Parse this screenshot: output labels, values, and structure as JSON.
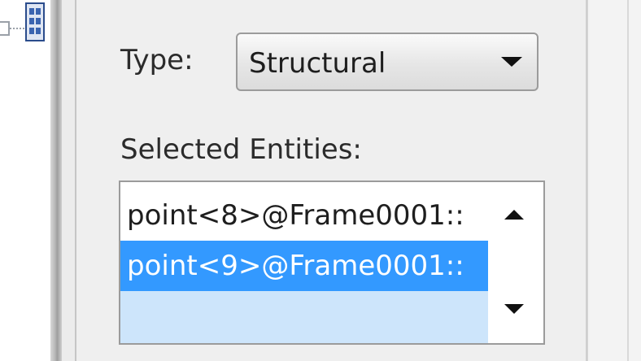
{
  "tree": {
    "node_icon": "frame-node-icon",
    "expander_icon": "tree-expander-icon"
  },
  "panel": {
    "type_label": "Type:",
    "type_value": "Structural",
    "entities_label": "Selected Entities:",
    "entities": [
      {
        "text": "point<8>@Frame0001::",
        "selected": false
      },
      {
        "text": "point<9>@Frame0001::",
        "selected": true
      }
    ],
    "icons": {
      "dropdown": "chevron-down-icon",
      "scroll_up": "scroll-up-icon",
      "scroll_down": "scroll-down-icon"
    }
  },
  "colors": {
    "selection": "#3399ff",
    "selection_light": "#cde5fb",
    "panel_bg": "#efefef"
  }
}
